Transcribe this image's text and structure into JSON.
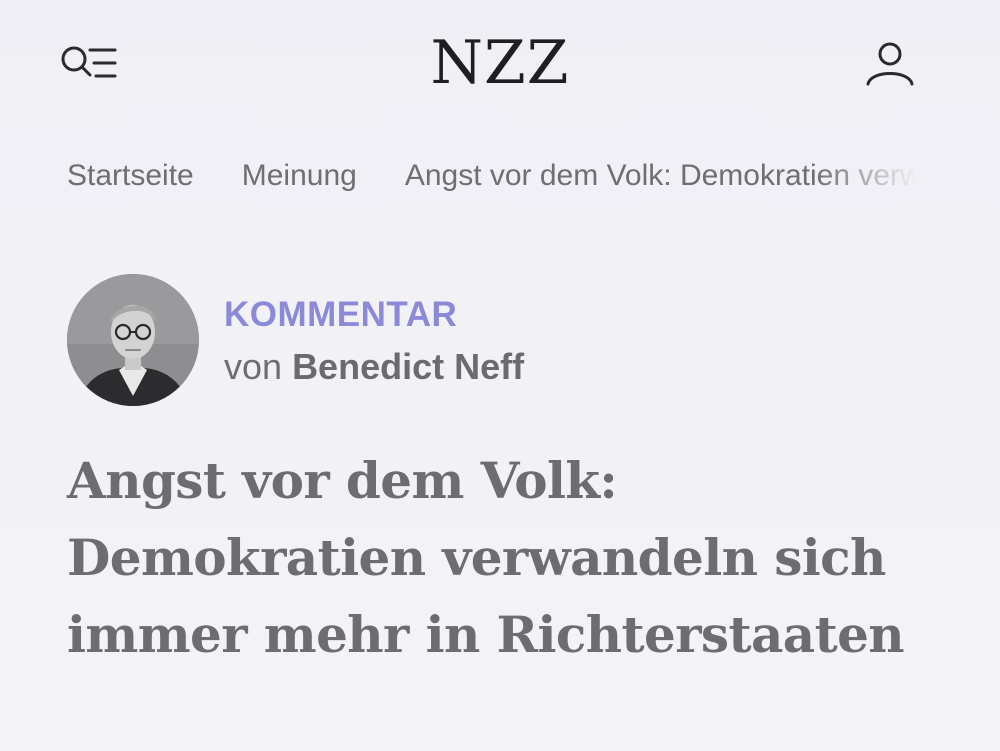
{
  "header": {
    "logo_text": "NZZ",
    "menu_icon": "search-menu-icon",
    "account_icon": "user-icon"
  },
  "breadcrumb": {
    "items": [
      {
        "label": "Startseite"
      },
      {
        "label": "Meinung"
      },
      {
        "label": "Angst vor dem Volk: Demokratien verwandeln sich immer mehr in Richterstaaten"
      }
    ],
    "separator_icon": "chevron-right-icon"
  },
  "article": {
    "kicker": "KOMMENTAR",
    "byline_prefix": "von",
    "author": "Benedict Neff",
    "headline": "Angst vor dem Volk: Demokratien verwandeln sich immer mehr in Richterstaaten"
  },
  "colors": {
    "kicker": "#8c8ad8",
    "text": "#6e6e72",
    "logo": "#1f1f22",
    "background": "#f1f1f6"
  }
}
